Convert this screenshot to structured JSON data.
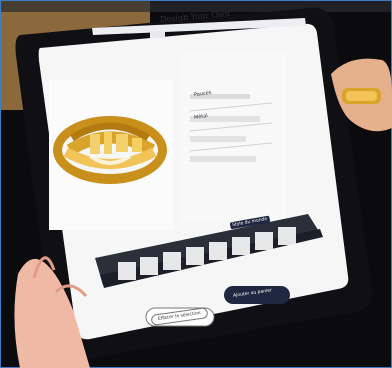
{
  "page": {
    "brand": "Design Your Own",
    "tabs": [
      "Style du monde"
    ],
    "buttons": {
      "secondary": "Effacer le sélection",
      "primary": "Ajouter au panier"
    },
    "ui_fields": [
      "Pouces",
      "Métal"
    ],
    "note": "Photo of a tablet UI for customizing a ring"
  },
  "colors": {
    "accent": "#1f2840",
    "gold": "#d8a42a",
    "background": "#0a0a0c"
  }
}
